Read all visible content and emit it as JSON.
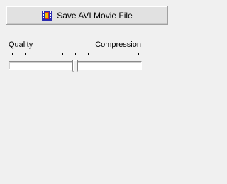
{
  "save_button": {
    "label": "Save AVI Movie File",
    "icon": "film-strip-icon"
  },
  "slider": {
    "min_label": "Quality",
    "max_label": "Compression",
    "tick_count": 11,
    "value_fraction": 0.5
  },
  "colors": {
    "background": "#f0f0f0",
    "button": "#e1e1e1",
    "track": "#ffffff",
    "icon_primary": "#2b2bb0",
    "icon_accent": "#cc2a2a"
  }
}
